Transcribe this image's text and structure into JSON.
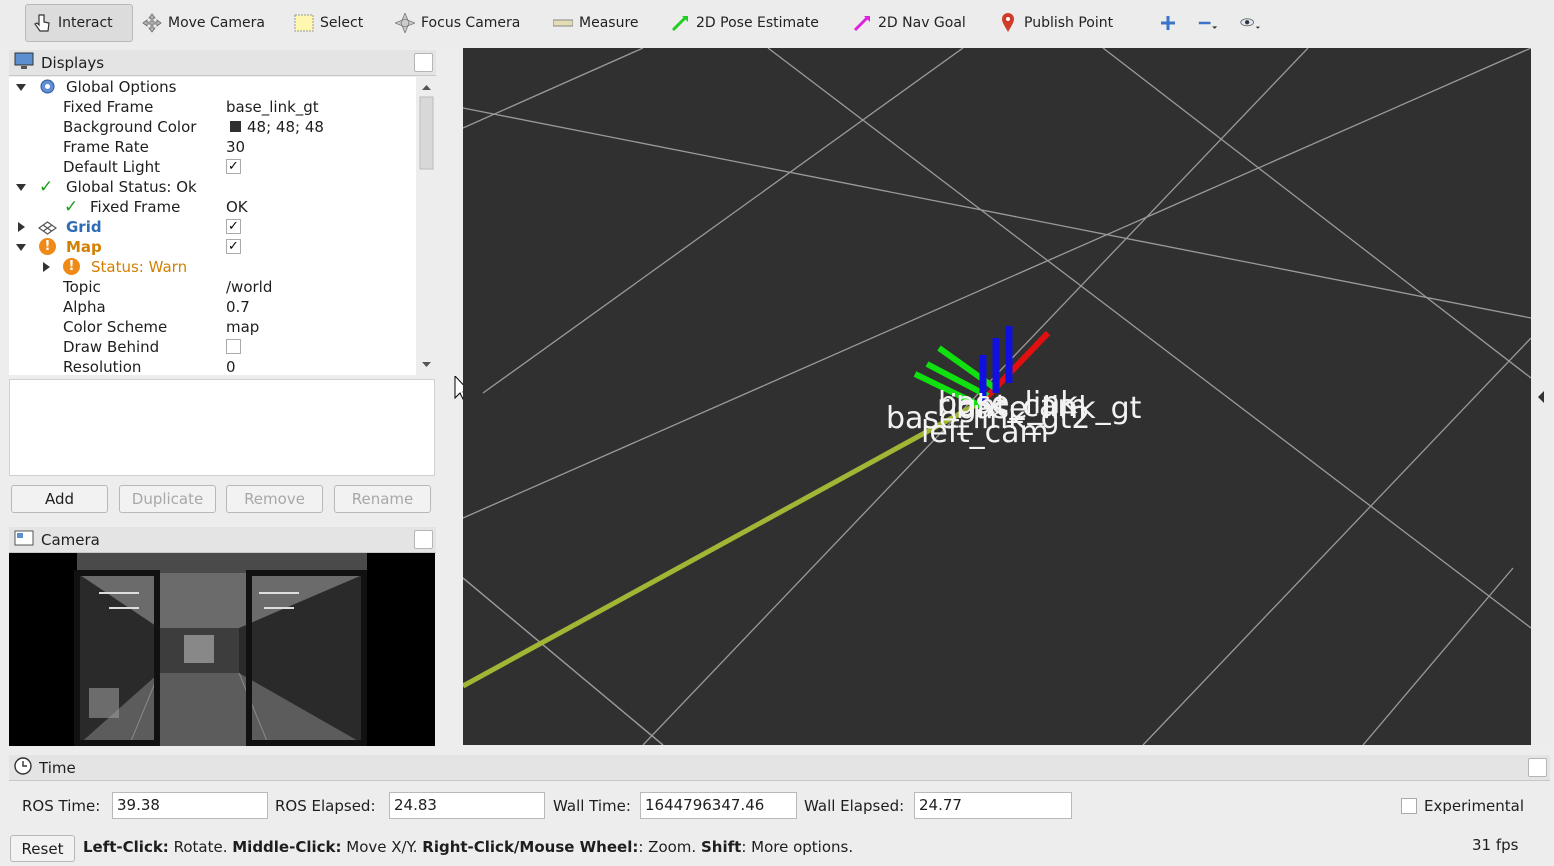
{
  "toolbar": {
    "tools": [
      {
        "label": "Interact",
        "icon": "hand-pointer-icon"
      },
      {
        "label": "Move Camera",
        "icon": "move-camera-icon"
      },
      {
        "label": "Select",
        "icon": "select-box-icon"
      },
      {
        "label": "Focus Camera",
        "icon": "focus-target-icon"
      },
      {
        "label": "Measure",
        "icon": "ruler-icon"
      },
      {
        "label": "2D Pose Estimate",
        "icon": "green-arrow-icon"
      },
      {
        "label": "2D Nav Goal",
        "icon": "magenta-arrow-icon"
      },
      {
        "label": "Publish Point",
        "icon": "map-pin-icon"
      }
    ]
  },
  "displays": {
    "title": "Displays",
    "rows": [
      {
        "label": "Global Options",
        "value": ""
      },
      {
        "label": "Fixed Frame",
        "value": "base_link_gt"
      },
      {
        "label": "Background Color",
        "value": "48; 48; 48"
      },
      {
        "label": "Frame Rate",
        "value": "30"
      },
      {
        "label": "Default Light",
        "value": "✓"
      },
      {
        "label": "Global Status: Ok",
        "value": ""
      },
      {
        "label": "Fixed Frame",
        "value": "OK"
      },
      {
        "label": "Grid",
        "value": "✓"
      },
      {
        "label": "Map",
        "value": "✓"
      },
      {
        "label": "Status: Warn",
        "value": ""
      },
      {
        "label": "Topic",
        "value": "/world"
      },
      {
        "label": "Alpha",
        "value": "0.7"
      },
      {
        "label": "Color Scheme",
        "value": "map"
      },
      {
        "label": "Draw Behind",
        "value": ""
      },
      {
        "label": "Resolution",
        "value": "0"
      }
    ],
    "buttons": {
      "add": "Add",
      "duplicate": "Duplicate",
      "remove": "Remove",
      "rename": "Rename"
    }
  },
  "camera": {
    "title": "Camera"
  },
  "scene": {
    "labels": [
      "base_link",
      "base_link_gt",
      "base_link_gt2",
      "right_cam",
      "left_cam"
    ],
    "background": "#303030"
  },
  "time": {
    "title": "Time",
    "ros_time_label": "ROS Time:",
    "ros_time": "39.38",
    "ros_elapsed_label": "ROS Elapsed:",
    "ros_elapsed": "24.83",
    "wall_time_label": "Wall Time:",
    "wall_time": "1644796347.46",
    "wall_elapsed_label": "Wall Elapsed:",
    "wall_elapsed": "24.77",
    "experimental": "Experimental"
  },
  "statusbar": {
    "reset": "Reset",
    "left_click": "Left-Click:",
    "left_click_action": " Rotate.",
    "middle_click": "Middle-Click:",
    "middle_click_action": " Move X/Y.",
    "right_click": "Right-Click/Mouse Wheel:",
    "right_click_action": ": Zoom.",
    "shift": "Shift",
    "shift_action": ": More options.",
    "fps": "31 fps"
  }
}
